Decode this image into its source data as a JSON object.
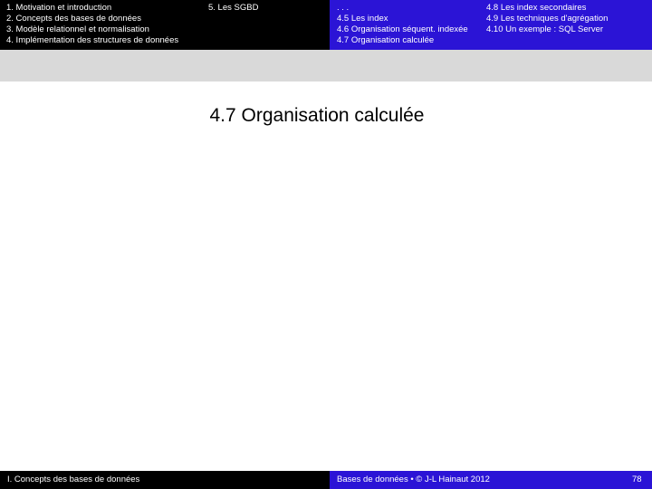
{
  "nav": {
    "chapters": [
      {
        "label": "1. Motivation et introduction"
      },
      {
        "label": "2. Concepts des bases de données"
      },
      {
        "label": "3. Modèle relationnel et normalisation"
      },
      {
        "label": "4. Implémentation des structures de données"
      }
    ],
    "chapter5": "5. Les SGBD",
    "sections_col1": [
      {
        "label": ". . ."
      },
      {
        "label": "4.5 Les index"
      },
      {
        "label": "4.6 Organisation séquent. indexée"
      },
      {
        "label": "4.7 Organisation calculée"
      }
    ],
    "sections_col2": [
      {
        "label": "4.8 Les index secondaires"
      },
      {
        "label": "4.9 Les techniques d'agrégation"
      },
      {
        "label": "4.10 Un exemple : SQL Server"
      }
    ]
  },
  "slide": {
    "title": "4.7  Organisation calculée"
  },
  "footer": {
    "left": "I. Concepts des bases de données",
    "center": "Bases de données • © J-L Hainaut 2012",
    "page_number": "78"
  },
  "colors": {
    "nav_left_bg": "#000000",
    "nav_right_bg": "#2b14d6",
    "band_bg": "#d9d9d9"
  }
}
